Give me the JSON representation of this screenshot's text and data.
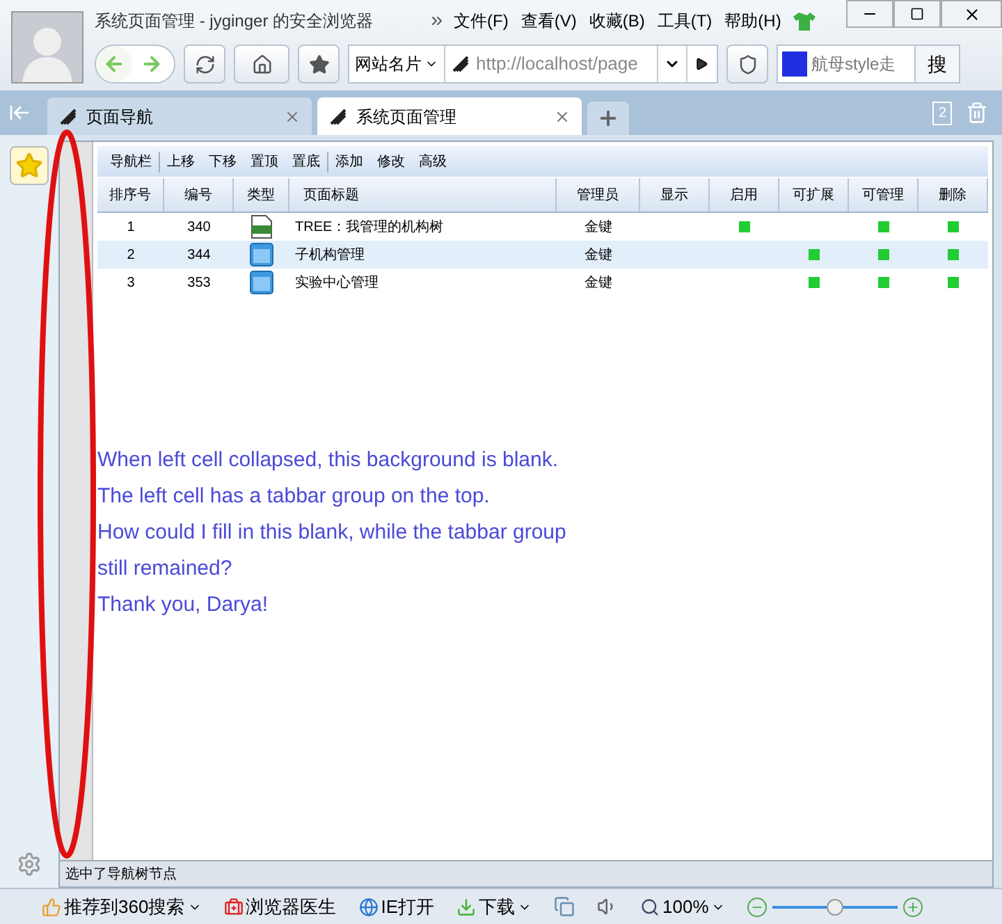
{
  "window": {
    "title": "系统页面管理 - jyginger 的安全浏览器"
  },
  "menu": [
    "文件(F)",
    "查看(V)",
    "收藏(B)",
    "工具(T)",
    "帮助(H)"
  ],
  "nav": {
    "sites_label": "网站名片",
    "url": "http://localhost/page",
    "search_placeholder": "航母style走",
    "search_button": "搜"
  },
  "tabs": [
    {
      "label": "页面导航",
      "selected": false
    },
    {
      "label": "系统页面管理",
      "selected": true
    }
  ],
  "tab_count": "2",
  "toolbar": [
    "导航栏",
    "上移",
    "下移",
    "置顶",
    "置底",
    "添加",
    "修改",
    "高级"
  ],
  "table": {
    "columns": [
      "排序号",
      "编号",
      "类型",
      "页面标题",
      "管理员",
      "显示",
      "启用",
      "可扩展",
      "可管理",
      "删除"
    ],
    "rows": [
      {
        "order": "1",
        "id": "340",
        "kind": "xml",
        "title": "TREE：我管理的机构树",
        "admin": "金键",
        "shown": false,
        "enabled": true,
        "expandable": false,
        "manageable": true,
        "deletable": true,
        "selected": false
      },
      {
        "order": "2",
        "id": "344",
        "kind": "folder",
        "title": "子机构管理",
        "admin": "金键",
        "shown": false,
        "enabled": false,
        "expandable": true,
        "manageable": true,
        "deletable": true,
        "selected": true
      },
      {
        "order": "3",
        "id": "353",
        "kind": "folder",
        "title": "实验中心管理",
        "admin": "金键",
        "shown": false,
        "enabled": false,
        "expandable": true,
        "manageable": true,
        "deletable": true,
        "selected": false
      }
    ]
  },
  "note": [
    "When left cell collapsed, this background is blank.",
    "The left cell has a tabbar group on the top.",
    "How could I fill in this blank, while the tabbar group",
    "still remained?",
    "Thank you, Darya!"
  ],
  "status_text": "选中了导航树节点",
  "bottom_bar": {
    "recommend": "推荐到360搜索",
    "doctor": "浏览器医生",
    "ie": "IE打开",
    "download": "下载",
    "zoom": "100%",
    "zoom_slider": {
      "level": 0.5
    }
  }
}
